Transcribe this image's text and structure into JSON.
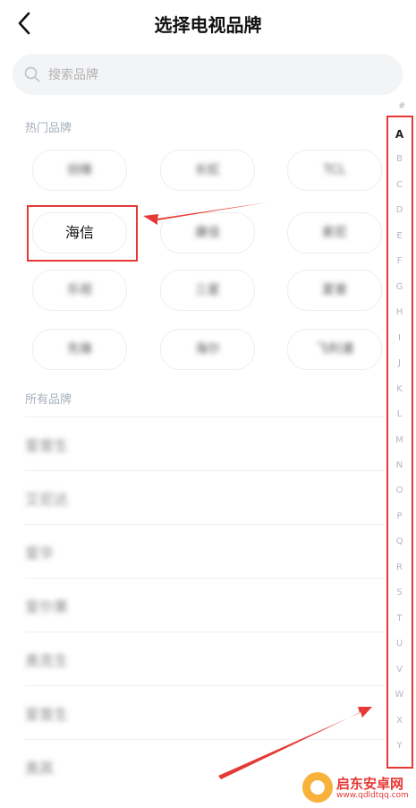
{
  "header": {
    "title": "选择电视品牌"
  },
  "search": {
    "placeholder": "搜索品牌"
  },
  "hot_brands": {
    "label": "热门品牌",
    "items": [
      {
        "label": "创维"
      },
      {
        "label": "长虹"
      },
      {
        "label": "TCL"
      },
      {
        "label": "海信"
      },
      {
        "label": "康佳"
      },
      {
        "label": "索尼"
      },
      {
        "label": "乐视"
      },
      {
        "label": "三星"
      },
      {
        "label": "夏普"
      },
      {
        "label": "先锋"
      },
      {
        "label": "海尔"
      },
      {
        "label": "飞利浦"
      }
    ]
  },
  "all_brands": {
    "label": "所有品牌",
    "items": [
      {
        "label": "爱普生"
      },
      {
        "label": "艾尼达"
      },
      {
        "label": "爱华"
      },
      {
        "label": "爱尔果"
      },
      {
        "label": "奥克生"
      },
      {
        "label": "爱普生"
      },
      {
        "label": "奥其"
      }
    ]
  },
  "alpha_index": {
    "hash": "#",
    "letters": [
      "A",
      "B",
      "C",
      "D",
      "E",
      "F",
      "G",
      "H",
      "I",
      "J",
      "K",
      "L",
      "M",
      "N",
      "O",
      "P",
      "Q",
      "R",
      "S",
      "T",
      "U",
      "V",
      "W",
      "X",
      "Y"
    ]
  },
  "watermark": {
    "title": "启东安卓网",
    "url": "www.qdldtqq.com"
  },
  "colors": {
    "annotation_red": "#e53935",
    "section_label": "#a6afbc"
  }
}
